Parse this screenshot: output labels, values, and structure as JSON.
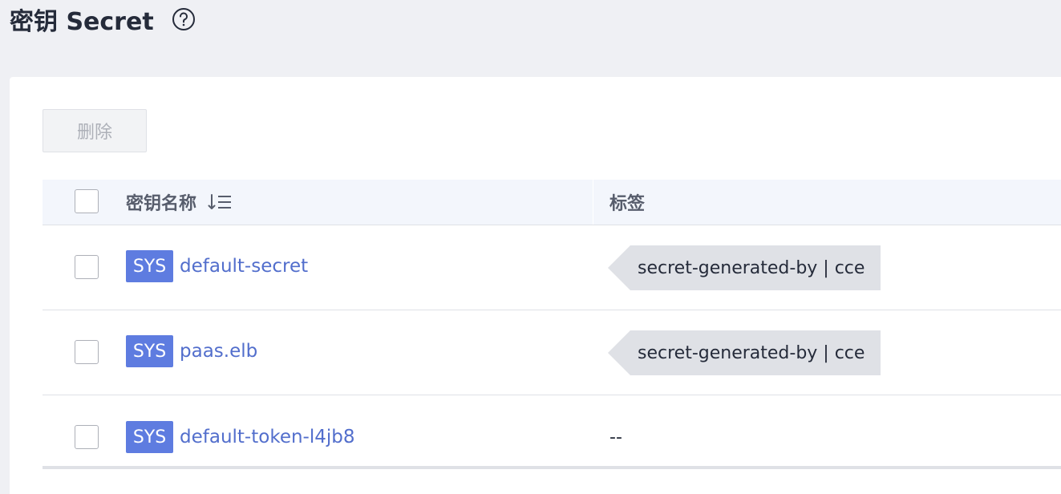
{
  "page": {
    "title": "密钥 Secret",
    "help_icon": "question-circle-icon"
  },
  "toolbar": {
    "delete_label": "删除"
  },
  "table": {
    "columns": {
      "name": "密钥名称",
      "labels": "标签",
      "sort_icon": "sort-descending-icon"
    },
    "rows": [
      {
        "badge": "SYS",
        "name": "default-secret",
        "tag": "secret-generated-by | cce"
      },
      {
        "badge": "SYS",
        "name": "paas.elb",
        "tag": "secret-generated-by | cce"
      },
      {
        "badge": "SYS",
        "name": "default-token-l4jb8",
        "labels_empty": "--"
      }
    ]
  },
  "colors": {
    "accent": "#5e7ce0",
    "link": "#526ecc",
    "page_background": "#eff0f4",
    "header_background": "#f3f6fc",
    "tag_background": "#dfe1e6"
  }
}
